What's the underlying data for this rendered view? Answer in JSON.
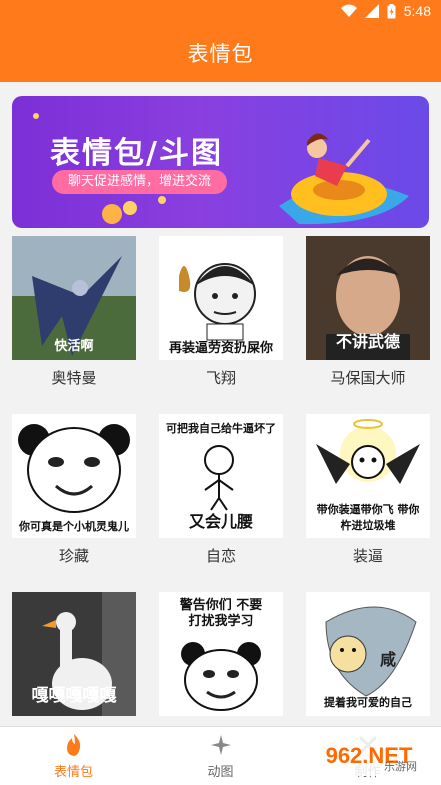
{
  "status": {
    "time": "5:48"
  },
  "appbar": {
    "title": "表情包"
  },
  "banner": {
    "title": "表情包/斗图",
    "subtitle": "聊天促进感情，增进交流"
  },
  "grid": {
    "items": [
      {
        "caption": "奥特曼",
        "text": "快活啊"
      },
      {
        "caption": "飞翔",
        "text": "再装逼劳资扔屎你"
      },
      {
        "caption": "马保国大师",
        "text": "不讲武德"
      },
      {
        "caption": "珍藏",
        "text": "你可真是个小机灵鬼儿"
      },
      {
        "caption": "自恋",
        "text_top": "可把我自己给牛逼坏了",
        "text": "又会儿腰"
      },
      {
        "caption": "装逼",
        "text": "带你装逼带你飞 带你杵进垃圾堆"
      },
      {
        "caption": "",
        "text": "嘎嘎嘎嘎嘎"
      },
      {
        "caption": "",
        "text": "警告你们 不要打扰我学习"
      },
      {
        "caption": "",
        "text": "提着我可爱的自己",
        "text_mid": "咸"
      }
    ]
  },
  "bottom_nav": {
    "tabs": [
      {
        "label": "表情包",
        "icon": "flame-icon",
        "active": true
      },
      {
        "label": "动图",
        "icon": "sparkle-icon",
        "active": false
      },
      {
        "label": "制作",
        "icon": "tools-icon",
        "active": false
      }
    ]
  },
  "watermark": {
    "text": "962.NET",
    "cn": "乐游网"
  },
  "colors": {
    "accent": "#ff7a1a",
    "banner": "#7b2fd6"
  }
}
